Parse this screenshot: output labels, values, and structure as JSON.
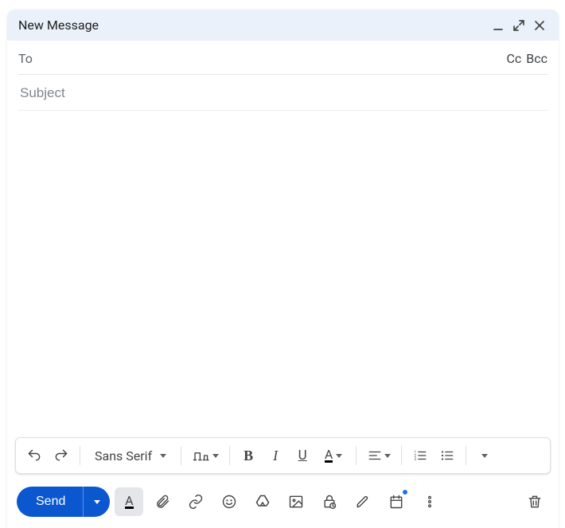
{
  "header": {
    "title": "New Message"
  },
  "to": {
    "label": "To",
    "value": "",
    "cc_label": "Cc",
    "bcc_label": "Bcc"
  },
  "subject": {
    "placeholder": "Subject",
    "value": ""
  },
  "body": {
    "text": ""
  },
  "format_toolbar": {
    "font": "Sans Serif"
  },
  "send": {
    "label": "Send"
  }
}
